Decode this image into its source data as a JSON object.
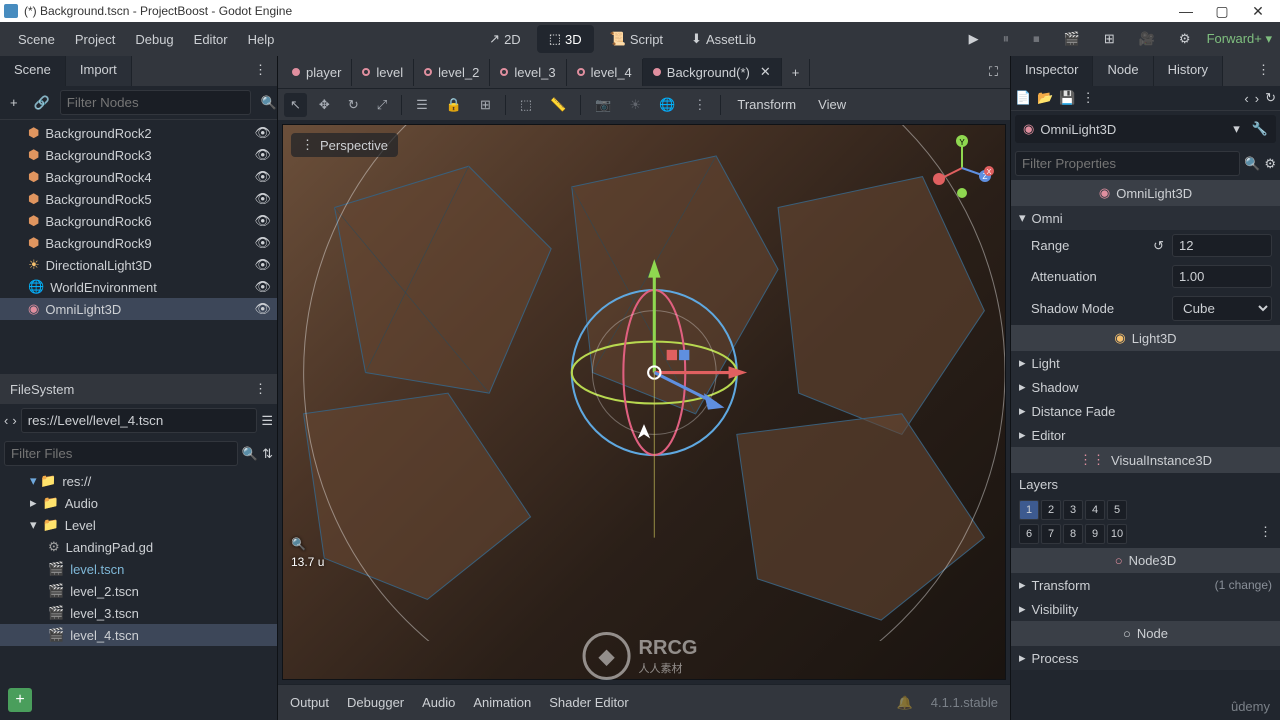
{
  "titlebar": {
    "title": "(*) Background.tscn - ProjectBoost - Godot Engine"
  },
  "menubar": {
    "items": [
      "Scene",
      "Project",
      "Debug",
      "Editor",
      "Help"
    ],
    "modes": {
      "m2d": "2D",
      "m3d": "3D",
      "script": "Script",
      "assetlib": "AssetLib"
    },
    "render_mode": "Forward+"
  },
  "left": {
    "tabs": {
      "scene": "Scene",
      "import": "Import"
    },
    "filter_placeholder": "Filter Nodes",
    "nodes": [
      {
        "name": "BackgroundRock2",
        "icon": "mesh"
      },
      {
        "name": "BackgroundRock3",
        "icon": "mesh"
      },
      {
        "name": "BackgroundRock4",
        "icon": "mesh"
      },
      {
        "name": "BackgroundRock5",
        "icon": "mesh"
      },
      {
        "name": "BackgroundRock6",
        "icon": "mesh"
      },
      {
        "name": "BackgroundRock9",
        "icon": "mesh"
      },
      {
        "name": "DirectionalLight3D",
        "icon": "light"
      },
      {
        "name": "WorldEnvironment",
        "icon": "env"
      },
      {
        "name": "OmniLight3D",
        "icon": "omni",
        "selected": true
      }
    ],
    "filesystem": {
      "title": "FileSystem",
      "path": "res://Level/level_4.tscn",
      "filter_placeholder": "Filter Files",
      "root": "res://",
      "items": [
        {
          "name": "Audio",
          "type": "folder",
          "indent": 1
        },
        {
          "name": "Level",
          "type": "folder",
          "indent": 1,
          "open": true
        },
        {
          "name": "LandingPad.gd",
          "type": "script",
          "indent": 2
        },
        {
          "name": "level.tscn",
          "type": "scene",
          "indent": 2,
          "link": true
        },
        {
          "name": "level_2.tscn",
          "type": "scene",
          "indent": 2
        },
        {
          "name": "level_3.tscn",
          "type": "scene",
          "indent": 2
        },
        {
          "name": "level_4.tscn",
          "type": "scene",
          "indent": 2,
          "selected": true
        }
      ]
    }
  },
  "center": {
    "tabs": [
      {
        "name": "player",
        "filled": true
      },
      {
        "name": "level"
      },
      {
        "name": "level_2"
      },
      {
        "name": "level_3"
      },
      {
        "name": "level_4"
      },
      {
        "name": "Background(*)",
        "active": true,
        "filled": true,
        "closable": true
      }
    ],
    "toolbar": {
      "transform": "Transform",
      "view": "View"
    },
    "viewport": {
      "perspective": "Perspective",
      "ruler": "13.7 u"
    },
    "bottom": {
      "output": "Output",
      "debugger": "Debugger",
      "audio": "Audio",
      "animation": "Animation",
      "shader": "Shader Editor",
      "version": "4.1.1.stable"
    }
  },
  "inspector": {
    "tabs": {
      "inspector": "Inspector",
      "node": "Node",
      "history": "History"
    },
    "node_name": "OmniLight3D",
    "filter_placeholder": "Filter Properties",
    "sections": {
      "omnilight3d": "OmniLight3D",
      "omni": "Omni",
      "range": {
        "label": "Range",
        "value": "12"
      },
      "attenuation": {
        "label": "Attenuation",
        "value": "1.00"
      },
      "shadow_mode": {
        "label": "Shadow Mode",
        "value": "Cube"
      },
      "light3d": "Light3D",
      "light": "Light",
      "shadow": "Shadow",
      "distance_fade": "Distance Fade",
      "editor": "Editor",
      "visualinstance3d": "VisualInstance3D",
      "layers": "Layers",
      "layer_nums": [
        "1",
        "2",
        "3",
        "4",
        "5",
        "6",
        "7",
        "8",
        "9",
        "10"
      ],
      "node3d": "Node3D",
      "transform": "Transform",
      "transform_change": "(1 change)",
      "visibility": "Visibility",
      "node": "Node",
      "process": "Process"
    }
  },
  "watermark": {
    "text": "RRCG",
    "sub": "人人素材"
  },
  "udemy": "ûdemy"
}
